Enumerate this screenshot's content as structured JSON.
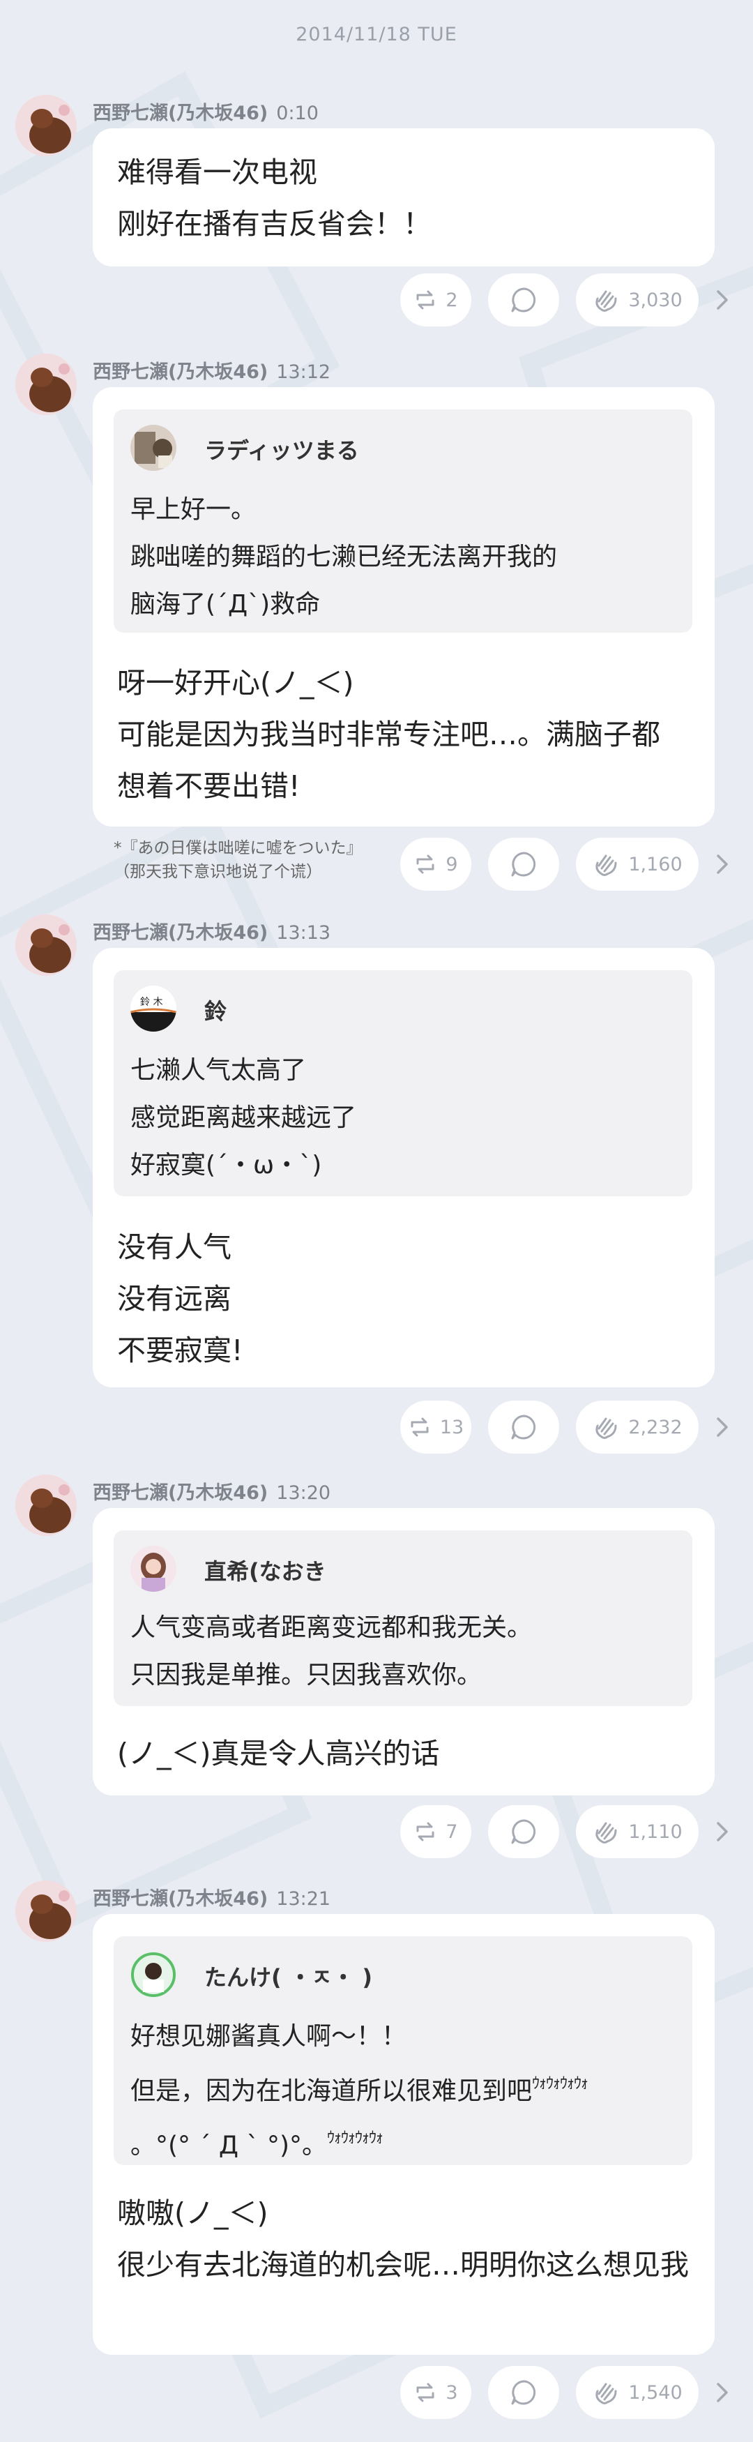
{
  "date_header": "2014/11/18 TUE",
  "sender_name": "西野七瀬(乃木坂46)",
  "messages": [
    {
      "time": "0:10",
      "lines": [
        "难得看一次电视",
        "刚好在播有吉反省会！！"
      ],
      "reposts": "2",
      "claps": "3,030"
    },
    {
      "time": "13:12",
      "quote": {
        "name": "ラディッツまる",
        "lines": [
          "早上好一。",
          "跳咄嗟的舞蹈的七濑已经无法离开我的",
          "脑海了(´Д`)救命"
        ]
      },
      "lines": [
        "呀一好开心(ノ_＜)",
        "可能是因为我当时非常专注吧…。满脑子都",
        "想着不要出错!"
      ],
      "footnote": [
        "*『あの日僕は咄嗟に嘘をついた』",
        "（那天我下意识地说了个谎）"
      ],
      "reposts": "9",
      "claps": "1,160"
    },
    {
      "time": "13:13",
      "quote": {
        "name": "鈴",
        "lines": [
          "七濑人气太高了",
          "感觉距离越来越远了",
          "好寂寞(´・ω・`)"
        ]
      },
      "lines": [
        "没有人气",
        "没有远离",
        "不要寂寞!"
      ],
      "reposts": "13",
      "claps": "2,232"
    },
    {
      "time": "13:20",
      "quote": {
        "name": "直希(なおき",
        "lines": [
          "人气变高或者距离变远都和我无关。",
          "只因我是单推。只因我喜欢你。"
        ]
      },
      "lines": [
        "(ノ_＜)真是令人高兴的话"
      ],
      "reposts": "7",
      "claps": "1,110"
    },
    {
      "time": "13:21",
      "quote": {
        "name": "たんけ( ・ㅈ・ )",
        "lines": [
          "好想见娜酱真人啊〜！！",
          "但是，因为在北海道所以很难见到吧",
          "。°(° ´ Д ` °)°。"
        ],
        "sup1": "ｳｫｳｫｳｫｳｫ",
        "sup2": "ｳｫｳｫｳｫｳｫ"
      },
      "lines": [
        "嗷嗷(ノ_＜)",
        "很少有去北海道的机会呢…明明你这么想见我"
      ],
      "reposts": "3",
      "claps": "1,540"
    }
  ]
}
